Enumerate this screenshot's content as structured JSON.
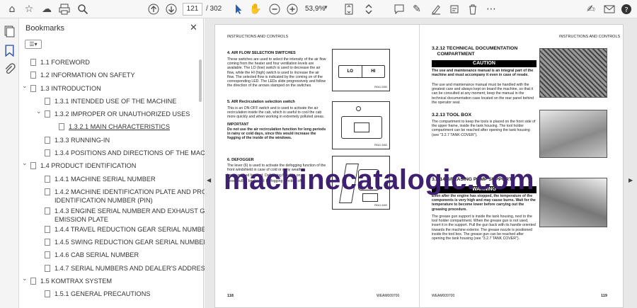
{
  "toolbar": {
    "page_current": "121",
    "page_total": "/ 302",
    "zoom": "53,9%"
  },
  "sidebar": {
    "title": "Bookmarks",
    "items": [
      {
        "label": "1.1 FOREWORD"
      },
      {
        "label": "1.2 INFORMATION ON SAFETY"
      },
      {
        "label": "1.3 INTRODUCTION"
      },
      {
        "label": "1.3.1 INTENDED USE OF THE MACHINE"
      },
      {
        "label": "1.3.2 IMPROPER OR UNAUTHORIZED USES"
      },
      {
        "label": "1.3.2.1 MAIN CHARACTERISTICS"
      },
      {
        "label": "1.3.3 RUNNING-IN"
      },
      {
        "label": "1.3.4 POSITIONS AND DIRECTIONS OF THE MACHINE"
      },
      {
        "label": "1.4 PRODUCT IDENTIFICATION"
      },
      {
        "label": "1.4.1 MACHINE SERIAL NUMBER"
      },
      {
        "label": "1.4.2 MACHINE IDENTIFICATION PLATE AND PRODUCT"
      },
      {
        "label": "IDENTIFICATION NUMBER (PIN)"
      },
      {
        "label": "1.4.3 ENGINE SERIAL NUMBER AND EXHAUST GAS"
      },
      {
        "label": "EMISSION PLATE"
      },
      {
        "label": "1.4.4 TRAVEL REDUCTION GEAR SERIAL NUMBER"
      },
      {
        "label": "1.4.5 SWING REDUCTION GEAR SERIAL NUMBER"
      },
      {
        "label": "1.4.6 CAB SERIAL NUMBER"
      },
      {
        "label": "1.4.7 SERIAL NUMBERS AND DEALER'S ADDRESS"
      },
      {
        "label": "1.5 KOMTRAX SYSTEM"
      },
      {
        "label": "1.5.1 GENERAL PRECAUTIONS"
      }
    ]
  },
  "document": {
    "left_header": "INSTRUCTIONS AND CONTROLS",
    "right_header": "INSTRUCTIONS AND CONTROLS",
    "s4_title": "4.    AIR FLOW SELECTION SWITCHES",
    "s4_text": "These switches are used to select the intensity of the air flow coming from the heater and four ventilation levels are available. The LO (low) switch is used to decrease the air flow, while the HI (high) switch is used to increase the air flow. The selected flow is indicated by the coming on of the corresponding LED. The LEDs slide progressively and follow the direction of the arrows stamped on the switches.",
    "s5_title": "5.    AIR Recirculation selection switch",
    "s5_text": "This is an ON-OFF switch and is used to activate the air recirculation inside the cab, which is useful to cool the cab more quickly and when working in extremely polluted areas.",
    "important_label": "IMPORTANT",
    "important_text": "Do not use the air recirculation function for long periods in rainy or cold days, since this would increase the fogging of the inside of the windows.",
    "s6_title": "6.    DEFOGGER",
    "s6_text": "The lever (6) is used to activate the defogging function of the front windshield in case of cold or rainy weather.",
    "s6_forward": "Lever pushed forward: Defogging function on.",
    "s6_backward": "Lever pulled backward: Defogging function off.",
    "lo_label": "LO",
    "hi_label": "HI",
    "fig1": "RKA1 0450",
    "fig2": "RKA1 0460",
    "fig3": "RKA1 0400",
    "sec212_title": "3.2.12 TECHNICAL DOCUMENTATION\n    COMPARTMENT",
    "caution": "CAUTION",
    "caution_text": "The use and maintenance manual is an integral part of the machine and must accompany it even in case of resale.",
    "sec212_text": "The use and maintenance manual must be handled with the greatest care and always kept on board the machine, so that it can be consulted at any moment; keep the manual in the technical documentation case located on the rear panel behind the operator seat.",
    "sec213_title": "3.2.13 TOOL BOX",
    "sec213_text": "The compartment to keep the tools is placed on the front side of the upper frame, inside the tank housing. The tool holder compartment can be reached after opening the tank housing (see \"3.2.7 TANK COVER\").",
    "sec214_title": "3.2.14 GREASING PUMP SUPPORT",
    "warning": "WARNING",
    "warning_text": "Even after the engine has stopped, the temperature of the components is very high and may cause burns. Wait for the temperature to become lower before carrying out the greasing procedure.",
    "sec214_text": "The grease gun support is inside the tank housing, next to the tool holder compartment. When the grease gun is not used, insert it in the support. Pull the gun back with its handle oriented towards the machine exterior. The grease nozzle is positioned inside the tool box. The grease gun can be reached after opening the tank housing (see \"3.2.7 TANK COVER\").",
    "left_page_num": "118",
    "left_code": "WEAM009700",
    "right_code": "WEAM009700",
    "right_page_num": "119",
    "watermark": "machinecatalogic.com"
  }
}
